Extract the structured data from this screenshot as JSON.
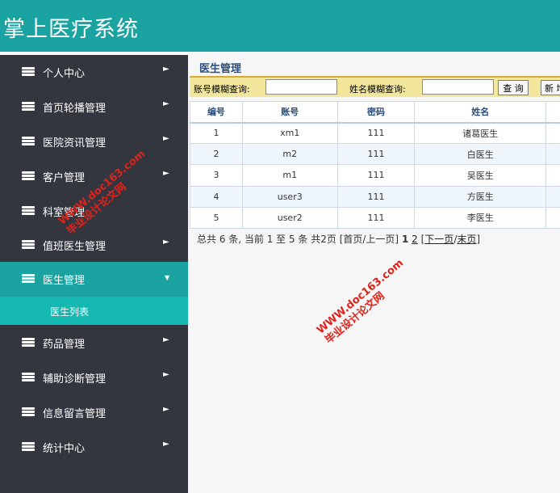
{
  "app": {
    "title": "掌上医疗系统"
  },
  "sidebar": {
    "items": [
      {
        "label": "个人中心",
        "arrow": "►"
      },
      {
        "label": "首页轮播管理",
        "arrow": "►"
      },
      {
        "label": "医院资讯管理",
        "arrow": "►"
      },
      {
        "label": "客户管理",
        "arrow": "►"
      },
      {
        "label": "科室管理",
        "arrow": "►"
      },
      {
        "label": "值班医生管理",
        "arrow": "►"
      },
      {
        "label": "医生管理",
        "arrow": "▼",
        "active": true
      },
      {
        "label": "药品管理",
        "arrow": "►"
      },
      {
        "label": "辅助诊断管理",
        "arrow": "►"
      },
      {
        "label": "信息留言管理",
        "arrow": "►"
      },
      {
        "label": "统计中心",
        "arrow": "►"
      }
    ],
    "sub_items": [
      {
        "label": "医生列表"
      }
    ]
  },
  "content": {
    "title": "医生管理",
    "search": {
      "account_label": "账号模糊查询:",
      "account_value": "",
      "name_label": "姓名模糊查询:",
      "name_value": "",
      "query_button": "查 询",
      "add_button": "新 增"
    },
    "table": {
      "columns": [
        "编号",
        "账号",
        "密码",
        "姓名"
      ],
      "rows": [
        [
          "1",
          "xm1",
          "111",
          "诸葛医生"
        ],
        [
          "2",
          "m2",
          "111",
          "白医生"
        ],
        [
          "3",
          "m1",
          "111",
          "吴医生"
        ],
        [
          "4",
          "user3",
          "111",
          "方医生"
        ],
        [
          "5",
          "user2",
          "111",
          "李医生"
        ]
      ]
    },
    "pager": {
      "summary": "总共 6 条, 当前 1 至 5 条 共2页",
      "first_prev": "[首页/上一页]",
      "current_page": "1",
      "page_two": "2",
      "next": "下一页",
      "separator": "/",
      "last": "末页",
      "bracket_open": "[",
      "bracket_close": "]"
    }
  },
  "watermark": {
    "url": "WWW.doc163.com",
    "site": "毕业设计论文网"
  },
  "colors": {
    "header": "#1aa3a0",
    "sidebar": "#33363e",
    "active_item": "#1aa3a0",
    "sub_item": "#16b8b2",
    "search_bar": "#f3e79e",
    "watermark": "#e0221a"
  }
}
